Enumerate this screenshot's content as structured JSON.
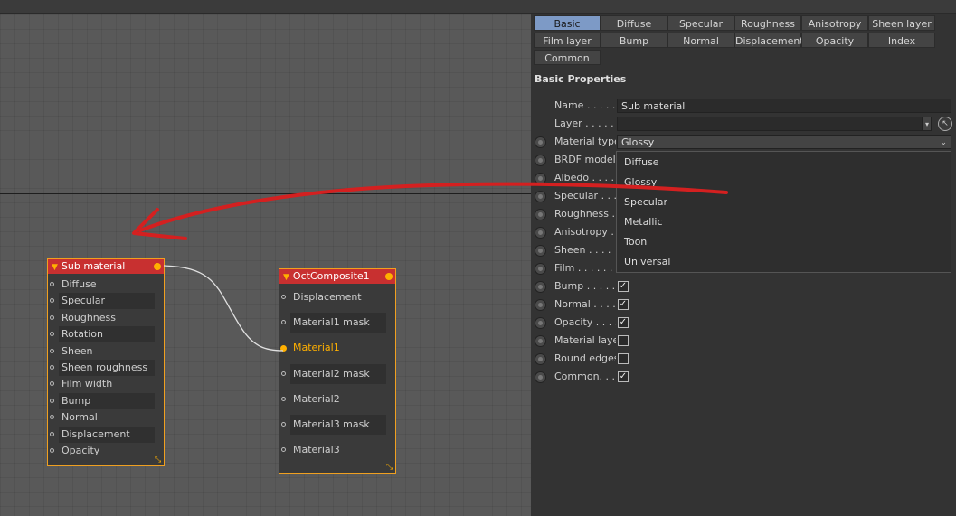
{
  "node_sub": {
    "title": "Sub material",
    "ports": [
      "Diffuse",
      "Specular",
      "Roughness",
      "Rotation",
      "Sheen",
      "Sheen roughness",
      "Film width",
      "Bump",
      "Normal",
      "Displacement",
      "Opacity"
    ]
  },
  "node_comp": {
    "title": "OctComposite1",
    "ports": [
      "Displacement",
      "Material1 mask",
      "Material1",
      "Material2 mask",
      "Material2",
      "Material3 mask",
      "Material3"
    ]
  },
  "tabs": [
    "Basic",
    "Diffuse",
    "Specular",
    "Roughness",
    "Anisotropy",
    "Sheen layer",
    "Film layer",
    "Bump",
    "Normal",
    "Displacement",
    "Opacity",
    "Index",
    "Common"
  ],
  "section_title": "Basic Properties",
  "name_label": "Name . . . . .",
  "name_value": "Sub material",
  "layer_label": "Layer . . . . .",
  "material_type_label": "Material type",
  "material_type_value": "Glossy",
  "rows": [
    "BRDF model",
    "Albedo . . . .",
    "Specular . . .",
    "Roughness . .",
    "Anisotropy . .",
    "Sheen . . . .",
    "Film . . . . . .",
    "Bump . . . . .",
    "Normal . . . .",
    "Opacity . . . .",
    "Material layer",
    "Round edges",
    "Common. . . ."
  ],
  "checkbox_labels": [
    "Bump . . . . .",
    "Normal . . . .",
    "Opacity . . . .",
    "Material layer",
    "Round edges",
    "Common. . . ."
  ],
  "checkbox_states": [
    true,
    true,
    true,
    false,
    false,
    true
  ],
  "dropdown_options": [
    "Diffuse",
    "Glossy",
    "Specular",
    "Metallic",
    "Toon",
    "Universal"
  ],
  "check_glyph": "✓",
  "colors": {
    "accent": "#f0a020",
    "node_header": "#c83030",
    "tab_active": "#7d9ac6",
    "annotation": "#d42020"
  },
  "icons": {
    "collapse": "triangle-down-icon",
    "pick": "pick-arrow-icon",
    "chevron": "chevron-down-icon"
  }
}
